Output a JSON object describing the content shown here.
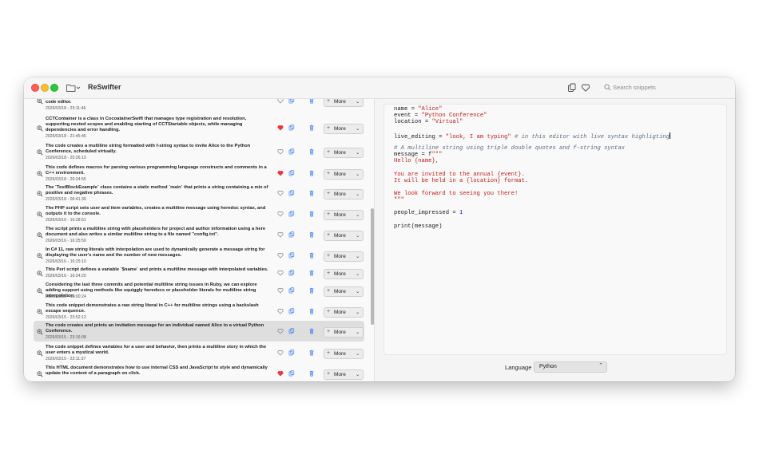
{
  "app": {
    "title": "ReSwifter"
  },
  "toolbar": {
    "search_placeholder": "Search snippets"
  },
  "snippets": [
    {
      "desc": "code editor.",
      "date": "2026/03/18 - 23:11:46",
      "favorite": false
    },
    {
      "desc": "CCTContainer is a class in CocoatainerSwift that manages type registration and resolution, supporting nested scopes and enabling starting of CCTStartable objects, while managing dependencies and error handling.",
      "date": "2026/03/18 - 21:45:45",
      "favorite": true
    },
    {
      "desc": "The code creates a multiline string formatted with f-string syntax to invite Alice to the Python Conference, scheduled virtually.",
      "date": "2026/03/18 - 20:26:10",
      "favorite": false
    },
    {
      "desc": "This code defines macros for parsing various programming language constructs and comments in a C++ environment.",
      "date": "2026/03/18 - 20:24:55",
      "favorite": true
    },
    {
      "desc": "The `TestBlockExample` class contains a static method `main` that prints a string containing a mix of positive and negative phrases.",
      "date": "2026/03/18 - 00:41:39",
      "favorite": false
    },
    {
      "desc": "The PHP script sets user and item variables, creates a multiline message using heredoc syntax, and outputs it to the console.",
      "date": "2026/03/16 - 16:28:51",
      "favorite": false
    },
    {
      "desc": "The script prints a multiline string with placeholders for project and author information using a here document and also writes a similar multiline string to a file named \"config.txt\".",
      "date": "2026/03/16 - 16:25:59",
      "favorite": false
    },
    {
      "desc": "In C# 11, raw string literals with interpolation are used to dynamically generate a message string for displaying the user's name and the number of new messages.",
      "date": "2026/03/16 - 16:25:10",
      "favorite": false
    },
    {
      "desc": "This Perl script defines a variable `$name` and prints a multiline message with interpolated variables.",
      "date": "2026/03/16 - 16:24:20",
      "favorite": false
    },
    {
      "desc": "Considering the last three commits and potential multiline string issues in Ruby, we can explore adding support using methods like squiggly heredocs or placeholder literals for multiline string interpolation.",
      "date": "2026/03/16 - 10:00:24",
      "favorite": false
    },
    {
      "desc": "This code snippet demonstrates a raw string literal in C++ for multiline strings using a backslash escape sequence.",
      "date": "2026/03/15 - 23:52:12",
      "favorite": false
    },
    {
      "desc": "The code creates and prints an invitation message for an individual named Alice to a virtual Python Conference.",
      "date": "2026/03/15 - 23:16:08",
      "favorite": false,
      "selected": true
    },
    {
      "desc": "The code snippet defines variables for a user and behavior, then prints a multiline story in which the user enters a mystical world.",
      "date": "2026/03/15 - 23:11:37",
      "favorite": false
    },
    {
      "desc": "This HTML document demonstrates how to use internal CSS and JavaScript to style and dynamically update the content of a paragraph on click.",
      "date": "",
      "favorite": true
    }
  ],
  "more_label": "More",
  "code_lines": [
    [
      [
        "name = ",
        ""
      ],
      [
        "\"Alice\"",
        "red"
      ]
    ],
    [
      [
        "event = ",
        ""
      ],
      [
        "\"Python Conference\"",
        "red"
      ]
    ],
    [
      [
        "location = ",
        ""
      ],
      [
        "\"Virtual\"",
        "red"
      ]
    ],
    [],
    [
      [
        "live_editing = ",
        ""
      ],
      [
        "\"look, I am typing\"",
        "red"
      ],
      [
        " # in this editor with live syntax highligting",
        "cmt"
      ]
    ],
    [],
    [
      [
        "# A multiline string using triple double quotes and f-string syntax",
        "cmt"
      ]
    ],
    [
      [
        "message = f",
        ""
      ],
      [
        "\"\"\"",
        "red"
      ]
    ],
    [
      [
        "Hello {name},",
        "red"
      ]
    ],
    [],
    [
      [
        "You are invited to the annual {event}.",
        "red"
      ]
    ],
    [
      [
        "It will be held in a {location} format.",
        "red"
      ]
    ],
    [],
    [
      [
        "We look forward to seeing you there!",
        "red"
      ]
    ],
    [
      [
        "\"\"\"",
        "red"
      ]
    ],
    [],
    [
      [
        "people_impressed = ",
        ""
      ],
      [
        "1",
        "blue"
      ]
    ],
    [],
    [
      [
        "print(message)",
        ""
      ]
    ]
  ],
  "language": {
    "label": "Language",
    "value": "Python"
  },
  "colors": {
    "favorite": "#e8383d",
    "action_blue": "#3478f6"
  }
}
